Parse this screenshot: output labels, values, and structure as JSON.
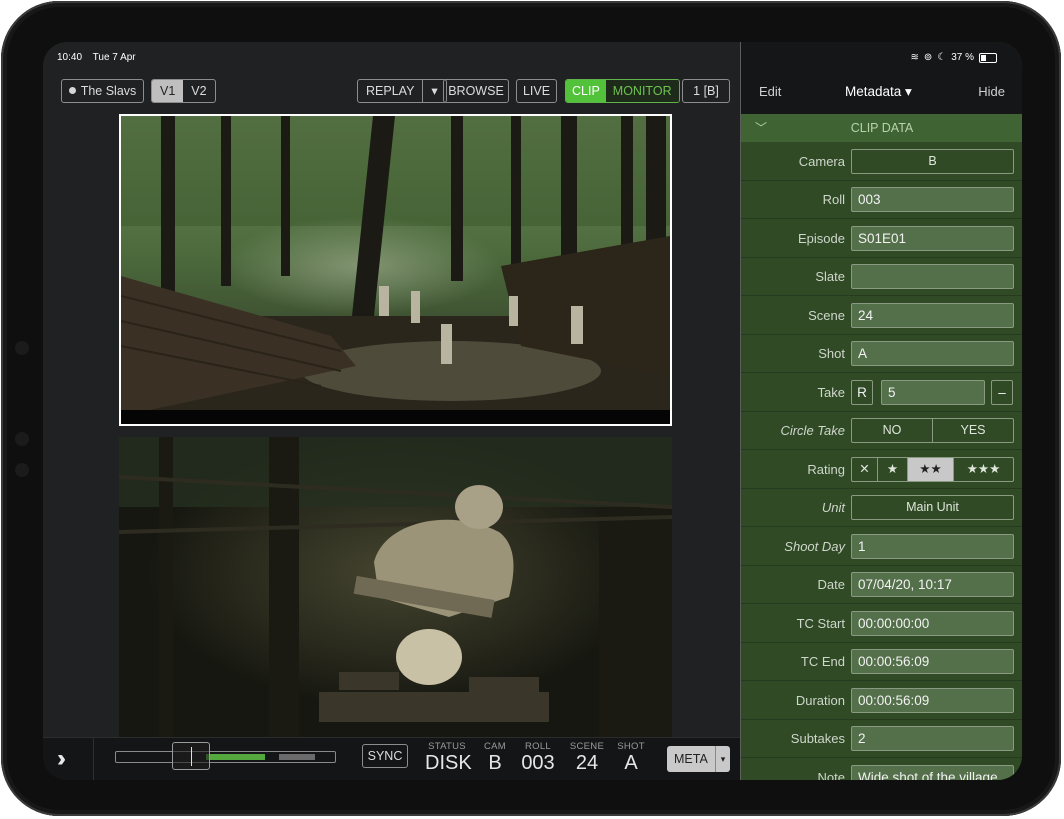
{
  "device": {
    "time": "10:40",
    "date": "Tue 7 Apr",
    "battery": "37 %"
  },
  "toolbar": {
    "project": "The Slavs",
    "v1": "V1",
    "v2": "V2",
    "replay": "REPLAY",
    "replay_caret": "▾",
    "browse": "BROWSE",
    "live": "LIVE",
    "clip": "CLIP",
    "monitor": "MONITOR",
    "cam_select": "1 [B]"
  },
  "bottom": {
    "sync": "SYNC",
    "progress": 0.35,
    "status_label": "STATUS",
    "status_value": "DISK",
    "cam_label": "CAM",
    "cam_value": "B",
    "roll_label": "ROLL",
    "roll_value": "003",
    "scene_label": "SCENE",
    "scene_value": "24",
    "shot_label": "SHOT",
    "shot_value": "A",
    "meta": "META",
    "meta_caret": "▾"
  },
  "panel": {
    "edit": "Edit",
    "title": "Metadata ▾",
    "hide": "Hide",
    "section": "CLIP DATA",
    "camera_label": "Camera",
    "camera_value": "B",
    "roll_label": "Roll",
    "roll_value": "003",
    "episode_label": "Episode",
    "episode_value": "S01E01",
    "slate_label": "Slate",
    "slate_value": "",
    "scene_label": "Scene",
    "scene_value": "24",
    "shot_label": "Shot",
    "shot_value": "A",
    "take_label": "Take",
    "take_r": "R",
    "take_value": "5",
    "take_minus": "–",
    "circle_label": "Circle Take",
    "circle_no": "NO",
    "circle_yes": "YES",
    "rating_label": "Rating",
    "rating_x": "✕",
    "rating_1": "★",
    "rating_2": "★★",
    "rating_3": "★★★",
    "rating_selected": 2,
    "unit_label": "Unit",
    "unit_value": "Main Unit",
    "shootday_label": "Shoot Day",
    "shootday_value": "1",
    "date_label": "Date",
    "date_value": "07/04/20, 10:17",
    "tcstart_label": "TC Start",
    "tcstart_value": "00:00:00:00",
    "tcend_label": "TC End",
    "tcend_value": "00:00:56:09",
    "duration_label": "Duration",
    "duration_value": "00:00:56:09",
    "subtakes_label": "Subtakes",
    "subtakes_value": "2",
    "note_label": "Note",
    "note_value": "Wide shot of the village"
  }
}
